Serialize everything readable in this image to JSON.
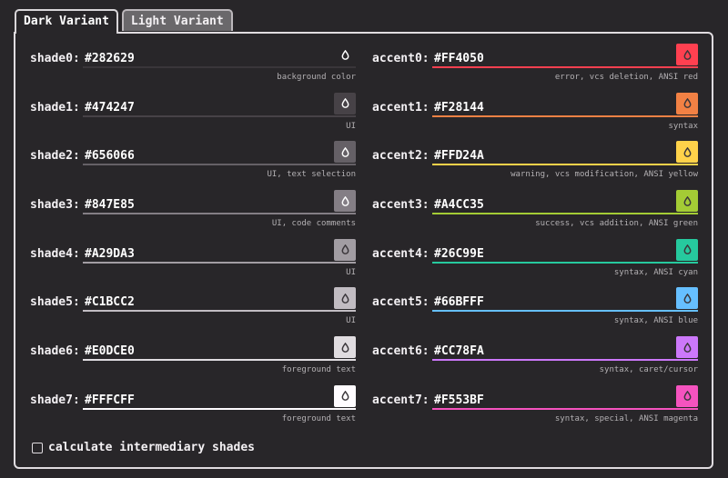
{
  "tabs": [
    {
      "label": "Dark Variant",
      "active": true
    },
    {
      "label": "Light Variant",
      "active": false
    }
  ],
  "shades": [
    {
      "label": "shade0:",
      "value": "#282629",
      "color": "#282629",
      "icon_color": "#ffffff",
      "desc": "background color"
    },
    {
      "label": "shade1:",
      "value": "#474247",
      "color": "#474247",
      "icon_color": "#ffffff",
      "desc": "UI"
    },
    {
      "label": "shade2:",
      "value": "#656066",
      "color": "#656066",
      "icon_color": "#ffffff",
      "desc": "UI, text selection"
    },
    {
      "label": "shade3:",
      "value": "#847E85",
      "color": "#847E85",
      "icon_color": "#ffffff",
      "desc": "UI, code comments"
    },
    {
      "label": "shade4:",
      "value": "#A29DA3",
      "color": "#A29DA3",
      "icon_color": "#3a363a",
      "desc": "UI"
    },
    {
      "label": "shade5:",
      "value": "#C1BCC2",
      "color": "#C1BCC2",
      "icon_color": "#3a363a",
      "desc": "UI"
    },
    {
      "label": "shade6:",
      "value": "#E0DCE0",
      "color": "#E0DCE0",
      "icon_color": "#3a363a",
      "desc": "foreground text"
    },
    {
      "label": "shade7:",
      "value": "#FFFCFF",
      "color": "#FFFCFF",
      "icon_color": "#3a363a",
      "desc": "foreground text"
    }
  ],
  "accents": [
    {
      "label": "accent0:",
      "value": "#FF4050",
      "color": "#FF4050",
      "icon_color": "#3a363a",
      "desc": "error, vcs deletion, ANSI red"
    },
    {
      "label": "accent1:",
      "value": "#F28144",
      "color": "#F28144",
      "icon_color": "#3a363a",
      "desc": "syntax"
    },
    {
      "label": "accent2:",
      "value": "#FFD24A",
      "color": "#FFD24A",
      "icon_color": "#3a363a",
      "desc": "warning, vcs modification, ANSI yellow"
    },
    {
      "label": "accent3:",
      "value": "#A4CC35",
      "color": "#A4CC35",
      "icon_color": "#3a363a",
      "desc": "success, vcs addition, ANSI green"
    },
    {
      "label": "accent4:",
      "value": "#26C99E",
      "color": "#26C99E",
      "icon_color": "#3a363a",
      "desc": "syntax, ANSI cyan"
    },
    {
      "label": "accent5:",
      "value": "#66BFFF",
      "color": "#66BFFF",
      "icon_color": "#3a363a",
      "desc": "syntax, ANSI blue"
    },
    {
      "label": "accent6:",
      "value": "#CC78FA",
      "color": "#CC78FA",
      "icon_color": "#3a363a",
      "desc": "syntax, caret/cursor"
    },
    {
      "label": "accent7:",
      "value": "#F553BF",
      "color": "#F553BF",
      "icon_color": "#3a363a",
      "desc": "syntax, special, ANSI magenta"
    }
  ],
  "checkbox": {
    "label": "calculate intermediary shades",
    "checked": false
  },
  "icons": {
    "swatch": "droplet-icon",
    "checkbox": "checkbox-icon"
  }
}
